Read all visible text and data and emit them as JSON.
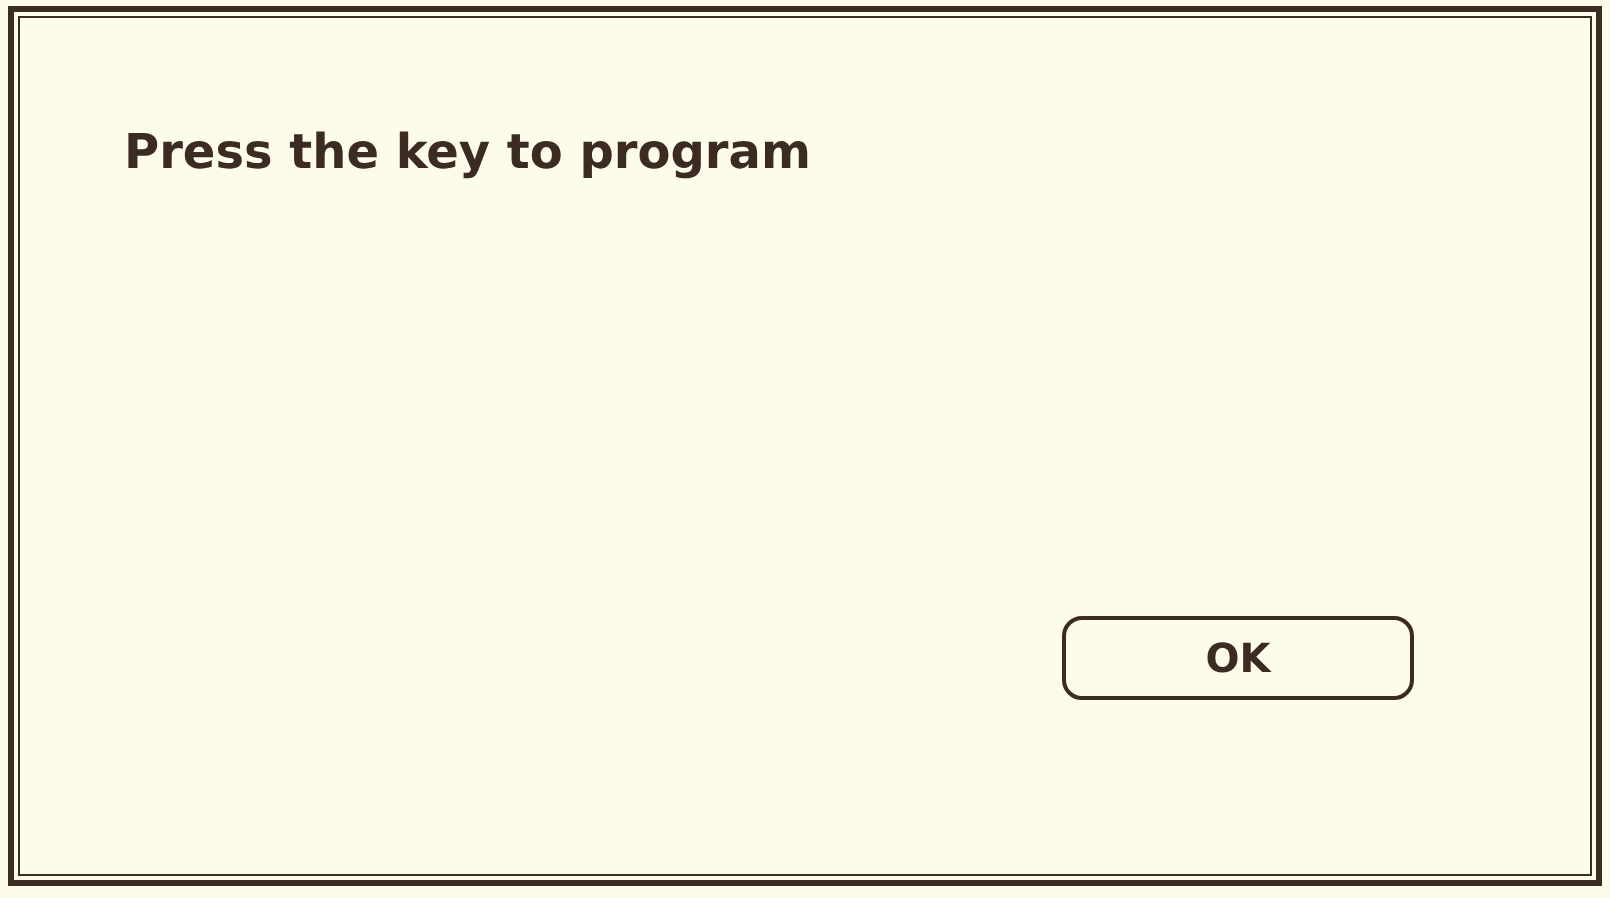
{
  "dialog": {
    "message": "Press the key to program",
    "buttons": [
      "OK"
    ]
  }
}
